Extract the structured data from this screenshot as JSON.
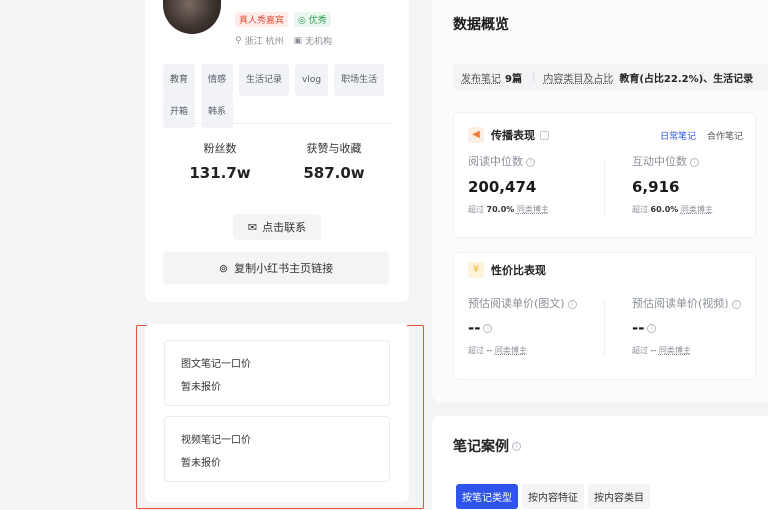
{
  "profile": {
    "badges": {
      "real_person": "真人秀嘉宾",
      "quality": "优秀"
    },
    "location": "浙江 杭州",
    "org": "无机构",
    "tags": [
      "教育",
      "情感",
      "生活记录",
      "vlog",
      "职场生活",
      "开箱",
      "韩系"
    ],
    "stats": [
      {
        "label": "粉丝数",
        "value": "131.7w"
      },
      {
        "label": "获赞与收藏",
        "value": "587.0w"
      }
    ],
    "contact_label": "点击联系",
    "copy_link_label": "复制小红书主页链接"
  },
  "pricing": [
    {
      "title": "图文笔记一口价",
      "value": "暂未报价"
    },
    {
      "title": "视频笔记一口价",
      "value": "暂未报价"
    }
  ],
  "overview": {
    "title": "数据概览",
    "summary": {
      "notes_label": "发布笔记",
      "notes_value": "9篇",
      "category_label": "内容类目及占比",
      "category_value": "教育(占比22.2%)、生活记录"
    },
    "spread": {
      "title": "传播表现",
      "tabs": [
        "日常笔记",
        "合作笔记"
      ],
      "metrics": [
        {
          "label": "阅读中位数",
          "value": "200,474",
          "exceed_prefix": "超过",
          "exceed_value": "70.0%",
          "exceed_suffix": "同类博主"
        },
        {
          "label": "互动中位数",
          "value": "6,916",
          "exceed_prefix": "超过",
          "exceed_value": "60.0%",
          "exceed_suffix": "同类博主"
        }
      ]
    },
    "value": {
      "title": "性价比表现",
      "metrics": [
        {
          "label": "预估阅读单价(图文)",
          "value": "--",
          "exceed_prefix": "超过",
          "exceed_value": "--",
          "exceed_suffix": "同类博主"
        },
        {
          "label": "预估阅读单价(视频)",
          "value": "--",
          "exceed_prefix": "超过",
          "exceed_value": "--",
          "exceed_suffix": "同类博主"
        }
      ]
    }
  },
  "cases": {
    "title": "笔记案例",
    "tabs": [
      "按笔记类型",
      "按内容特征",
      "按内容类目"
    ]
  },
  "colors": {
    "accent": "#2f54eb",
    "highlight_border": "#e0533a",
    "spread_icon": "#f07c3a",
    "value_icon": "#f5b82e"
  }
}
